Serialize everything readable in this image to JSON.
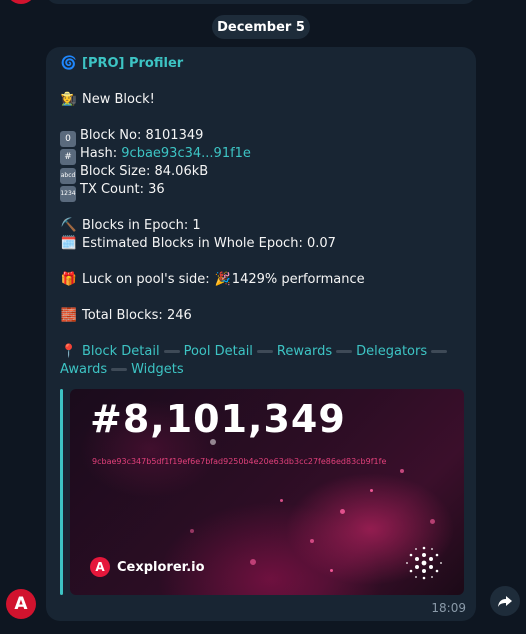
{
  "date_separator": "December 5",
  "message": {
    "sender_icon": "cyclone-emoji",
    "sender": "[PRO] Profiler",
    "headline_icon": "farmer-emoji",
    "headline": "New Block!",
    "details": [
      {
        "icon": "keycap-0",
        "label": "Block No: ",
        "value": "8101349"
      },
      {
        "icon": "keycap-hash",
        "label": "Hash: ",
        "link": "9cbae93c34...91f1e"
      },
      {
        "icon": "keycap-abcd",
        "label": "Block Size: ",
        "value": "84.06kB"
      },
      {
        "icon": "keycap-1234",
        "label": "TX Count: ",
        "value": "36"
      }
    ],
    "epoch": [
      {
        "icon": "pick-emoji",
        "label": "Blocks in Epoch: ",
        "value": "1"
      },
      {
        "icon": "calendar-emoji",
        "label": "Estimated Blocks in Whole Epoch: ",
        "value": "0.07"
      }
    ],
    "luck": {
      "icon": "gift-emoji",
      "label": "Luck on pool's side: ",
      "party_icon": "party-popper-emoji",
      "value": "1429% performance"
    },
    "total": {
      "icon": "bricks-emoji",
      "label": "Total Blocks: ",
      "value": "246"
    },
    "links": {
      "pin_icon": "pin-emoji",
      "block_detail": "Block Detail",
      "pool_detail": "Pool Detail",
      "rewards": "Rewards",
      "delegators": "Delegators",
      "awards": "Awards",
      "widgets": "Widgets"
    },
    "preview": {
      "block_number": "#8,101,349",
      "hash": "9cbae93c347b5df1f19ef6e7bfad9250b4e20e63db3cc27fe86ed83cb9f1fe",
      "brand": "Cexplorer.io",
      "brand_logo": "cexplorer-logo",
      "chain_icon": "cardano-logo"
    },
    "time": "18:09"
  },
  "colors": {
    "background": "#0e1621",
    "bubble": "#182533",
    "link": "#3dc4c4",
    "accent_red": "#d1132e"
  }
}
